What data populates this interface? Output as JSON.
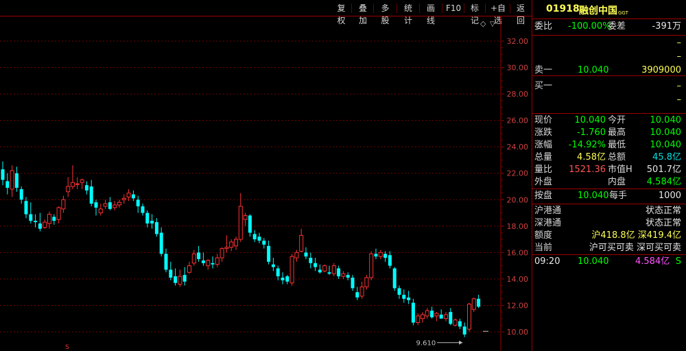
{
  "toolbar": {
    "buttons": [
      "复权",
      "叠加",
      "多股",
      "统计",
      "画线",
      "F10",
      "标记",
      "+自选",
      "返回"
    ]
  },
  "stock": {
    "code": "01918",
    "name": "融创中国",
    "tag": "GGT"
  },
  "order_ratio": {
    "label1": "委比",
    "value1": "-100.00%",
    "label2": "委差",
    "value2": "-391万"
  },
  "asks": [
    {
      "label": "",
      "price": "",
      "vol": "–"
    },
    {
      "label": "",
      "price": "",
      "vol": "–"
    },
    {
      "label": "卖一",
      "price": "10.040",
      "vol": "3909000"
    }
  ],
  "bids": [
    {
      "label": "买一",
      "price": "",
      "vol": "–"
    },
    {
      "label": "",
      "price": "",
      "vol": "–"
    },
    {
      "label": "",
      "price": "",
      "vol": "–"
    }
  ],
  "quote": [
    {
      "l1": "现价",
      "v1": "10.040",
      "l2": "今开",
      "v2": "10.040"
    },
    {
      "l1": "涨跌",
      "v1": "-1.760",
      "l2": "最高",
      "v2": "10.040"
    },
    {
      "l1": "涨幅",
      "v1": "-14.92%",
      "l2": "最低",
      "v2": "10.040"
    },
    {
      "l1": "总量",
      "v1": "4.58亿",
      "l2": "总额",
      "v2": "45.8亿"
    },
    {
      "l1": "量比",
      "v1": "1521.36",
      "l2": "市值H",
      "v2": "501.7亿"
    },
    {
      "l1": "外盘",
      "v1": "",
      "l2": "内盘",
      "v2": "4.584亿"
    }
  ],
  "lot": {
    "l1": "按盘",
    "v1": "10.040",
    "l2": "每手",
    "v2": "1000"
  },
  "connect": [
    {
      "l": "沪港通",
      "v": "状态正常"
    },
    {
      "l": "深港通",
      "v": "状态正常"
    },
    {
      "l": "额度",
      "v": "沪418.8亿 深419.4亿"
    },
    {
      "l": "当前",
      "v": "沪可买可卖 深可买可卖"
    }
  ],
  "tick": {
    "time": "09:20",
    "price": "10.040",
    "vol": "4.584亿",
    "side": "S"
  },
  "chart_data": {
    "type": "candlestick",
    "y_ticks": [
      "32.00",
      "30.00",
      "28.00",
      "26.00",
      "24.00",
      "22.00",
      "20.00",
      "18.00",
      "16.00",
      "14.00",
      "12.00",
      "10.00"
    ],
    "ylim": [
      9,
      33
    ],
    "low_marker": "9.610",
    "candles": [
      [
        22.3,
        22.9,
        21.1,
        21.5
      ],
      [
        21.4,
        22.0,
        20.4,
        20.9
      ],
      [
        20.8,
        22.6,
        20.2,
        22.2
      ],
      [
        22.0,
        22.5,
        20.6,
        20.9
      ],
      [
        20.8,
        21.0,
        19.7,
        20.0
      ],
      [
        19.9,
        20.2,
        18.6,
        18.9
      ],
      [
        18.9,
        19.8,
        18.2,
        18.4
      ],
      [
        18.4,
        18.9,
        17.9,
        18.3
      ],
      [
        18.2,
        19.0,
        17.6,
        17.8
      ],
      [
        17.9,
        18.5,
        17.8,
        18.3
      ],
      [
        18.2,
        19.1,
        17.8,
        18.9
      ],
      [
        18.7,
        18.9,
        18.1,
        18.4
      ],
      [
        18.5,
        19.5,
        18.2,
        19.4
      ],
      [
        19.3,
        20.3,
        19.0,
        20.0
      ],
      [
        20.6,
        21.7,
        20.2,
        21.0
      ],
      [
        21.0,
        22.6,
        20.8,
        21.3
      ],
      [
        21.2,
        21.7,
        20.8,
        21.2
      ],
      [
        21.3,
        21.6,
        20.8,
        21.5
      ],
      [
        21.1,
        21.4,
        20.4,
        20.7
      ],
      [
        21.0,
        21.5,
        19.5,
        19.7
      ],
      [
        19.8,
        20.0,
        18.8,
        19.4
      ],
      [
        19.0,
        19.7,
        18.8,
        19.3
      ],
      [
        19.5,
        20.0,
        19.3,
        19.7
      ],
      [
        19.8,
        20.2,
        19.2,
        19.3
      ],
      [
        19.4,
        19.9,
        19.2,
        19.6
      ],
      [
        19.6,
        20.0,
        19.4,
        19.8
      ],
      [
        20.0,
        20.4,
        19.7,
        20.1
      ],
      [
        20.2,
        20.8,
        19.9,
        20.5
      ],
      [
        20.4,
        20.7,
        19.9,
        20.1
      ],
      [
        20.0,
        20.3,
        19.0,
        19.5
      ],
      [
        19.5,
        19.7,
        18.8,
        19.0
      ],
      [
        19.0,
        19.2,
        17.9,
        18.2
      ],
      [
        18.4,
        18.9,
        17.8,
        18.2
      ],
      [
        18.3,
        18.6,
        17.2,
        17.4
      ],
      [
        17.5,
        17.9,
        15.7,
        15.9
      ],
      [
        15.9,
        16.3,
        14.5,
        14.7
      ],
      [
        14.7,
        15.3,
        13.9,
        14.1
      ],
      [
        14.2,
        14.8,
        13.5,
        13.7
      ],
      [
        13.6,
        14.7,
        13.4,
        14.2
      ],
      [
        14.3,
        14.9,
        13.5,
        13.8
      ],
      [
        14.5,
        15.3,
        14.4,
        15.0
      ],
      [
        15.2,
        16.2,
        15.0,
        15.9
      ],
      [
        16.0,
        16.5,
        15.3,
        15.5
      ],
      [
        15.4,
        16.0,
        15.0,
        15.2
      ],
      [
        15.0,
        15.5,
        14.7,
        15.4
      ],
      [
        15.2,
        15.7,
        14.8,
        15.1
      ],
      [
        15.1,
        15.9,
        14.9,
        15.6
      ],
      [
        15.6,
        16.4,
        15.3,
        16.3
      ],
      [
        16.3,
        17.3,
        16.0,
        16.4
      ],
      [
        16.4,
        17.0,
        16.1,
        16.8
      ],
      [
        16.5,
        17.2,
        16.2,
        17.0
      ],
      [
        17.0,
        20.5,
        16.8,
        19.5
      ],
      [
        18.5,
        19.0,
        18.0,
        18.8
      ],
      [
        18.8,
        18.9,
        17.2,
        17.5
      ],
      [
        17.4,
        17.7,
        16.8,
        17.0
      ],
      [
        17.2,
        17.5,
        16.7,
        16.9
      ],
      [
        16.9,
        17.1,
        16.3,
        16.6
      ],
      [
        16.5,
        16.9,
        15.1,
        15.3
      ],
      [
        15.1,
        15.6,
        14.6,
        14.9
      ],
      [
        14.8,
        15.0,
        13.9,
        14.2
      ],
      [
        14.1,
        14.5,
        13.6,
        13.9
      ],
      [
        14.2,
        14.3,
        13.6,
        13.8
      ],
      [
        13.7,
        15.9,
        13.5,
        15.7
      ],
      [
        15.6,
        16.2,
        15.3,
        16.0
      ],
      [
        16.1,
        17.8,
        16.0,
        17.3
      ],
      [
        16.0,
        16.4,
        15.5,
        15.7
      ],
      [
        15.6,
        16.0,
        14.8,
        15.2
      ],
      [
        15.2,
        15.6,
        14.6,
        14.9
      ],
      [
        14.7,
        15.1,
        14.4,
        14.5
      ],
      [
        14.6,
        15.1,
        14.5,
        15.0
      ],
      [
        14.5,
        15.0,
        14.3,
        14.4
      ],
      [
        14.4,
        15.2,
        14.2,
        15.0
      ],
      [
        14.8,
        15.0,
        14.0,
        14.2
      ],
      [
        14.2,
        14.6,
        14.0,
        14.4
      ],
      [
        14.3,
        14.5,
        13.9,
        14.1
      ],
      [
        14.1,
        14.3,
        13.1,
        13.3
      ],
      [
        13.0,
        13.4,
        12.4,
        12.6
      ],
      [
        12.7,
        13.8,
        12.5,
        13.4
      ],
      [
        13.4,
        14.3,
        13.2,
        14.1
      ],
      [
        14.1,
        16.1,
        13.9,
        15.9
      ],
      [
        15.9,
        16.3,
        15.5,
        15.7
      ],
      [
        15.7,
        16.2,
        15.5,
        16.0
      ],
      [
        15.9,
        16.1,
        15.3,
        15.6
      ],
      [
        15.8,
        16.1,
        14.8,
        15.0
      ],
      [
        14.8,
        14.9,
        13.1,
        13.3
      ],
      [
        13.3,
        13.5,
        12.5,
        12.8
      ],
      [
        12.8,
        13.2,
        12.2,
        12.5
      ],
      [
        12.6,
        13.1,
        12.1,
        12.4
      ],
      [
        12.2,
        12.5,
        10.5,
        10.7
      ],
      [
        10.7,
        11.4,
        10.5,
        11.2
      ],
      [
        11.0,
        11.5,
        10.7,
        11.3
      ],
      [
        11.2,
        11.8,
        11.0,
        11.6
      ],
      [
        11.6,
        11.9,
        11.0,
        11.1
      ],
      [
        11.2,
        11.5,
        10.8,
        11.4
      ],
      [
        11.3,
        11.7,
        11.0,
        11.0
      ],
      [
        11.0,
        11.5,
        10.8,
        11.3
      ],
      [
        11.5,
        11.8,
        10.5,
        10.6
      ],
      [
        10.5,
        11.0,
        10.4,
        10.9
      ],
      [
        10.8,
        11.0,
        10.2,
        10.4
      ],
      [
        10.4,
        10.7,
        9.6,
        9.8
      ],
      [
        10.2,
        12.2,
        10.0,
        12.1
      ],
      [
        11.7,
        12.6,
        11.5,
        12.5
      ],
      [
        12.5,
        12.8,
        11.8,
        11.9
      ]
    ]
  }
}
